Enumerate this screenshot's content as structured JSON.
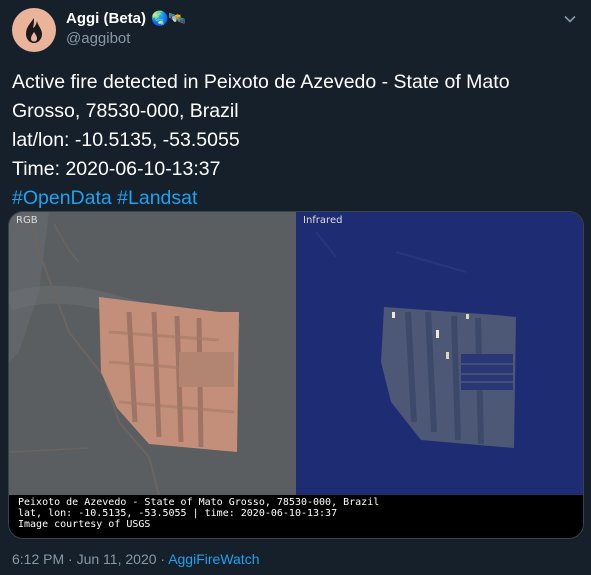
{
  "account": {
    "display_name": "Aggi (Beta)",
    "emoji": "🌏🛰️",
    "handle": "@aggibot"
  },
  "tweet": {
    "lines": [
      "Active fire detected in Peixoto de Azevedo - State of Mato",
      "Grosso, 78530-000, Brazil",
      "lat/lon: -10.5135, -53.5055",
      "Time: 2020-06-10-13:37"
    ],
    "hashtags": [
      "#OpenData",
      "#Landsat"
    ]
  },
  "media": {
    "left_label": "RGB",
    "right_label": "Infrared",
    "caption_lines": [
      "Peixoto de Azevedo - State of Mato Grosso, 78530-000, Brazil",
      "lat, lon: -10.5135, -53.5055 | time: 2020-06-10-13:37",
      "Image courtesy of USGS"
    ]
  },
  "meta": {
    "time": "6:12 PM",
    "separator": " · ",
    "date": "Jun 11, 2020",
    "separator2": " · ",
    "source": "AggiFireWatch"
  },
  "colors": {
    "background": "#15202b",
    "accent": "#1da1f2",
    "muted": "#8899a6"
  }
}
